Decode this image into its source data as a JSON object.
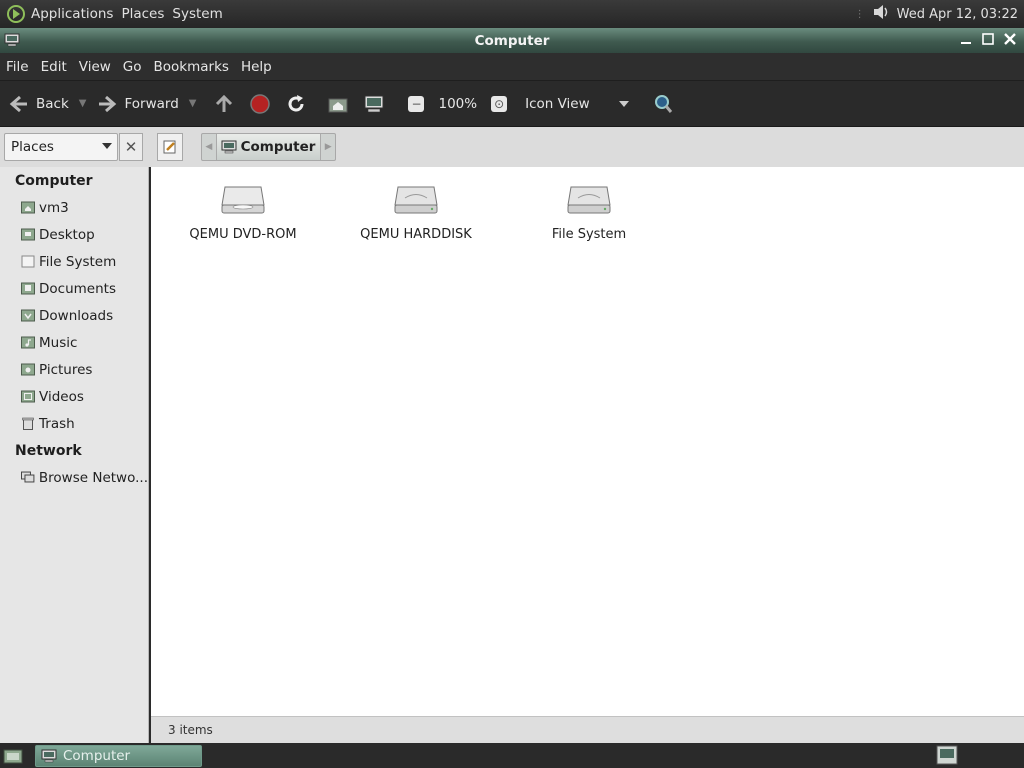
{
  "top_panel": {
    "menus": [
      "Applications",
      "Places",
      "System"
    ],
    "clock": "Wed Apr 12, 03:22",
    "icons": [
      "distro-logo-icon",
      "volume-icon"
    ]
  },
  "window": {
    "title": "Computer"
  },
  "menubar": [
    "File",
    "Edit",
    "View",
    "Go",
    "Bookmarks",
    "Help"
  ],
  "toolbar": {
    "back_label": "Back",
    "forward_label": "Forward",
    "zoom": "100%",
    "view_mode": "Icon View"
  },
  "location": {
    "side_pane": "Places",
    "crumb": "Computer"
  },
  "sidebar": {
    "sections": [
      {
        "title": "Computer",
        "items": [
          "vm3",
          "Desktop",
          "File System",
          "Documents",
          "Downloads",
          "Music",
          "Pictures",
          "Videos",
          "Trash"
        ]
      },
      {
        "title": "Network",
        "items": [
          "Browse Netwo..."
        ]
      }
    ]
  },
  "files": [
    {
      "name": "QEMU DVD-ROM",
      "icon": "optical-drive-icon"
    },
    {
      "name": "QEMU HARDDISK",
      "icon": "harddisk-icon"
    },
    {
      "name": "File System",
      "icon": "harddisk-icon"
    }
  ],
  "status": "3 items",
  "taskbar": {
    "task_label": "Computer"
  },
  "colors": {
    "accent": "#5c8474",
    "titlebar": "#3f5a4f"
  }
}
